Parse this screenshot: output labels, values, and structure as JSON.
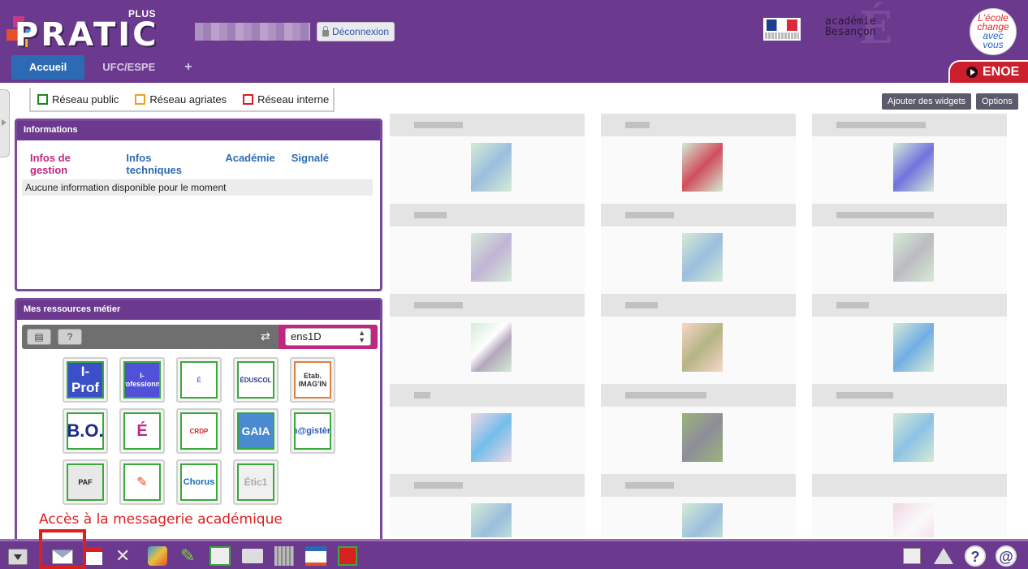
{
  "header": {
    "logo_text": "PRATIC",
    "logo_plus": "PLUS",
    "logout_label": "Déconnexion",
    "academy_line1": "académie",
    "academy_line2": "Besançon",
    "ecole_line1": "L'école",
    "ecole_line2": "change",
    "ecole_line3": "avec",
    "ecole_line4": "vous",
    "enoe_label": "ENOE"
  },
  "tabs": [
    {
      "label": "Accueil",
      "active": true
    },
    {
      "label": "UFC/ESPE",
      "active": false
    },
    {
      "label": "+",
      "active": false
    }
  ],
  "legend": [
    {
      "label": "Réseau public",
      "color": "#1a8a1a"
    },
    {
      "label": "Réseau agriates",
      "color": "#f0a020"
    },
    {
      "label": "Réseau interne",
      "color": "#d81e1e"
    }
  ],
  "informations": {
    "title": "Informations",
    "tabs": [
      "Infos de gestion",
      "Infos techniques",
      "Académie",
      "Signalé"
    ],
    "active_tab": "Infos de gestion",
    "message": "Aucune information disponible pour le moment"
  },
  "ressources": {
    "title": "Mes ressources métier",
    "select_value": "ens1D",
    "help_label": "?",
    "icons": [
      {
        "name": "iprof",
        "label": "I-Prof"
      },
      {
        "name": "ipro",
        "label": "I-Professionnel"
      },
      {
        "name": "ministere",
        "label": "É"
      },
      {
        "name": "eduscol",
        "label": "ÉDUSCOL"
      },
      {
        "name": "etab-imagin",
        "label": "Etab. IMAG'IN"
      },
      {
        "name": "bo",
        "label": "B.O."
      },
      {
        "name": "academie",
        "label": "É"
      },
      {
        "name": "orange",
        "label": "CRDP"
      },
      {
        "name": "gaia",
        "label": "GAIA"
      },
      {
        "name": "magistere",
        "label": "m@gistère"
      },
      {
        "name": "paf",
        "label": "PAF"
      },
      {
        "name": "chat",
        "label": "✎"
      },
      {
        "name": "chorus",
        "label": "Chorus"
      },
      {
        "name": "etic",
        "label": "Étic1"
      }
    ]
  },
  "annotation": "Accès à la messagerie académique",
  "widgets_toolbar": {
    "add_label": "Ajouter des widgets",
    "options_label": "Options"
  },
  "bottombar": {
    "help_label": "?",
    "at_label": "@"
  }
}
